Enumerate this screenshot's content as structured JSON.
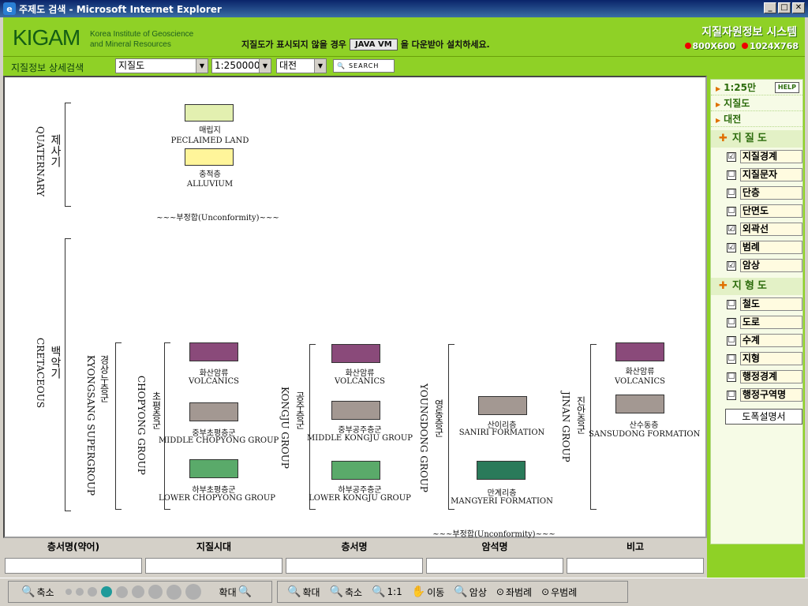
{
  "window": {
    "title": "주제도 검색 - Microsoft Internet Explorer"
  },
  "header": {
    "logo": "KIGAM",
    "logo_sub_1": "Korea Institute of Geoscience",
    "logo_sub_2": "and Mineral Resources",
    "notice_pre": "지질도가 표시되지 않을 경우",
    "java_button": "JAVA VM",
    "notice_post": "을 다운받아 설치하세요.",
    "system_title": "지질자원정보 시스템",
    "res_800": "800X600",
    "res_1024": "1024X768"
  },
  "search": {
    "label": "지질정보 상세검색",
    "map_type": "지질도",
    "scale": "1:250000",
    "region": "대전",
    "search_button": "SEARCH"
  },
  "legend": {
    "quaternary_ko": "제사기",
    "quaternary_en": "QUATERNARY",
    "cretaceous_ko": "백악기",
    "cretaceous_en": "CRETACEOUS",
    "kyongsang_ko": "경상누층군",
    "kyongsang_en": "KYONGSANG SUPERGROUP",
    "reclaimed_ko": "매립지",
    "reclaimed_en": "PECLAIMED LAND",
    "alluvium_ko": "충적층",
    "alluvium_en": "ALLUVIUM",
    "unconformity": "~~~부정합(Unconformity)~~~",
    "chopyong_ko": "초평층군",
    "chopyong_en": "CHOPYONG GROUP",
    "kongju_ko": "공주층군",
    "kongju_en": "KONGJU GROUP",
    "youngdong_ko": "영동층군",
    "youngdong_en": "YOUNGDONG GROUP",
    "jinan_ko": "진안층군",
    "jinan_en": "JINAN GROUP",
    "volcanics_ko": "화산암류",
    "volcanics_en": "VOLCANICS",
    "mid_chopyong_ko": "중부초평층군",
    "mid_chopyong_en": "MIDDLE CHOPYONG GROUP",
    "low_chopyong_ko": "하부초평층군",
    "low_chopyong_en": "LOWER CHOPYONG GROUP",
    "mid_kongju_ko": "중부공주층군",
    "mid_kongju_en": "MIDDLE KONGJU GROUP",
    "low_kongju_ko": "하부공주층군",
    "low_kongju_en": "LOWER KONGJU GROUP",
    "saniri_ko": "산이리층",
    "saniri_en": "SANIRI FORMATION",
    "mangyeri_ko": "만계리층",
    "mangyeri_en": "MANGYERI FORMATION",
    "sansudong_ko": "산수동층",
    "sansudong_en": "SANSUDONG FORMATION",
    "colors": {
      "reclaimed": "#e3f0b0",
      "alluvium": "#fff59a",
      "volcanics": "#8a4a7a",
      "gray": "#a39892",
      "green": "#5aaa6a",
      "darkgreen": "#2a7a5a"
    }
  },
  "panel": {
    "scale": "1:25만",
    "help": "HELP",
    "map_type": "지질도",
    "region": "대전",
    "geo_section": "지질도",
    "geo_items": [
      {
        "label": "지질경계",
        "checked": "☑"
      },
      {
        "label": "지질문자",
        "checked": "☐"
      },
      {
        "label": "단층",
        "checked": "☐"
      },
      {
        "label": "단면도",
        "checked": "☐"
      },
      {
        "label": "외곽선",
        "checked": "☑"
      },
      {
        "label": "범례",
        "checked": "☑"
      },
      {
        "label": "암상",
        "checked": "☑"
      }
    ],
    "topo_section": "지형도",
    "topo_items": [
      {
        "label": "철도",
        "checked": "☐"
      },
      {
        "label": "도로",
        "checked": "☐"
      },
      {
        "label": "수계",
        "checked": "☐"
      },
      {
        "label": "지형",
        "checked": "☐"
      },
      {
        "label": "행정경계",
        "checked": "☐"
      },
      {
        "label": "행정구역명",
        "checked": "☐"
      }
    ],
    "doc_button": "도폭설명서"
  },
  "table": {
    "headers": [
      "층서명(약어)",
      "지질시대",
      "층서명",
      "암석명",
      "비고"
    ]
  },
  "toolbar": {
    "zoom_out": "축소",
    "zoom_in": "확대",
    "tool_zoom_in": "확대",
    "tool_zoom_out": "축소",
    "tool_ratio": "1:1",
    "tool_move": "이동",
    "tool_lith": "암상",
    "tool_left_legend": "좌범례",
    "tool_right_legend": "우범례"
  }
}
